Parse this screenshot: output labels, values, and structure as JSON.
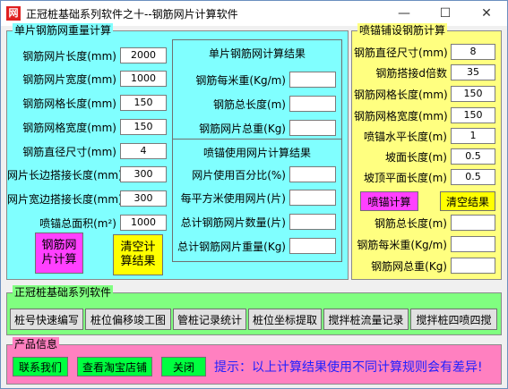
{
  "window": {
    "title": "正冠桩基础系列软件之十--钢筋网片计算软件",
    "icon_char": "网",
    "minimize": "—",
    "maximize": "☐",
    "close": "✕"
  },
  "left_group": {
    "title": "单片钢筋网重量计算",
    "fields": [
      {
        "label": "钢筋网片长度(mm)",
        "value": "2000"
      },
      {
        "label": "钢筋网片宽度(mm)",
        "value": "1000"
      },
      {
        "label": "钢筋网格长度(mm)",
        "value": "150"
      },
      {
        "label": "钢筋网格宽度(mm)",
        "value": "150"
      },
      {
        "label": "钢筋直径尺寸(mm)",
        "value": "4"
      },
      {
        "label": "网片长边搭接长度(mm)",
        "value": "300"
      },
      {
        "label": "网片宽边搭接长度(mm)",
        "value": "300"
      },
      {
        "label": "喷锚总面积(m²)",
        "value": "1000"
      }
    ],
    "calc_button": "钢筋网片计算",
    "clear_button": "清空计算结果",
    "result_box": {
      "title": "单片钢筋网计算结果",
      "fields": [
        {
          "label": "钢筋每米重(Kg/m)",
          "value": ""
        },
        {
          "label": "钢筋总长度(m)",
          "value": ""
        },
        {
          "label": "钢筋网片总重(Kg)",
          "value": ""
        }
      ]
    },
    "use_box": {
      "title": "喷锚使用网片计算结果",
      "fields": [
        {
          "label": "网片使用百分比(%)",
          "value": ""
        },
        {
          "label": "每平方米使用网片(片)",
          "value": ""
        },
        {
          "label": "总计钢筋网片数量(片)",
          "value": ""
        },
        {
          "label": "总计钢筋网片重量(Kg)",
          "value": ""
        }
      ]
    }
  },
  "right_group": {
    "title": "喷锚铺设钢筋计算",
    "fields": [
      {
        "label": "钢筋直径尺寸(mm)",
        "value": "8"
      },
      {
        "label": "钢筋搭接d倍数",
        "value": "35"
      },
      {
        "label": "钢筋网格长度(mm)",
        "value": "150"
      },
      {
        "label": "钢筋网格宽度(mm)",
        "value": "150"
      },
      {
        "label": "喷锚水平长度(m)",
        "value": "1"
      },
      {
        "label": "坡面长度(m)",
        "value": "0.5"
      },
      {
        "label": "坡顶平面长度(m)",
        "value": "0.5"
      }
    ],
    "calc_button": "喷锚计算",
    "clear_button": "清空结果",
    "results": [
      {
        "label": "钢筋总长度(m)",
        "value": ""
      },
      {
        "label": "钢筋每米重(Kg/m)",
        "value": ""
      },
      {
        "label": "钢筋网总重(Kg)",
        "value": ""
      }
    ]
  },
  "series_group": {
    "title": "正冠桩基础系列软件",
    "buttons": [
      "桩号快速编写",
      "桩位偏移竣工图",
      "管桩记录统计",
      "桩位坐标提取",
      "搅拌桩流量记录",
      "搅拌桩四喷四搅"
    ]
  },
  "product_group": {
    "title": "产品信息",
    "buttons": [
      "联系我们",
      "查看淘宝店铺",
      "关闭"
    ],
    "hint": "提示：以上计算结果使用不同计算规则会有差异!"
  }
}
